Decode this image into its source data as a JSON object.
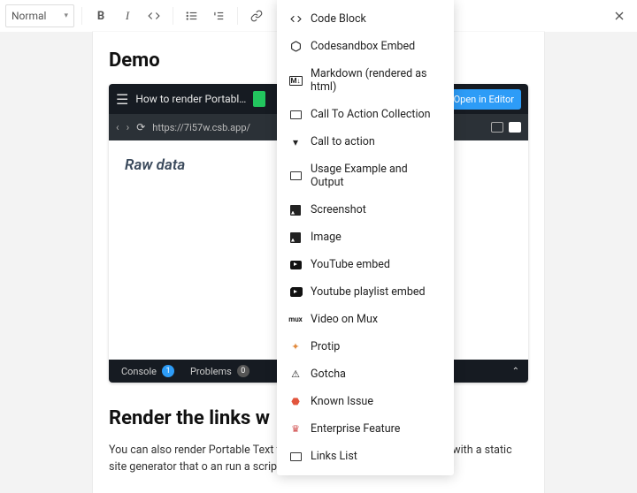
{
  "toolbar": {
    "format_select": "Normal"
  },
  "content": {
    "heading_demo": "Demo",
    "embed": {
      "title": "How to render Portabl…",
      "open_in_editor": "Open in Editor",
      "url": "https://7i57w.csb.app/",
      "body_title": "Raw data",
      "tab_console": "Console",
      "console_count": "1",
      "tab_problems": "Problems",
      "problems_count": "0"
    },
    "heading_render": "Render the links w",
    "paragraph": "You can also render Portable Text to Ma                                                     nt to use content from Sanity with a static site generator that o                                                     an run a script that"
  },
  "menu": {
    "items": [
      {
        "icon": "code-block-icon",
        "label": "Code Block"
      },
      {
        "icon": "codesandbox-icon",
        "label": "Codesandbox Embed"
      },
      {
        "icon": "markdown-icon",
        "label": "Markdown (rendered as html)"
      },
      {
        "icon": "cta-collection-icon",
        "label": "Call To Action Collection"
      },
      {
        "icon": "cta-icon",
        "label": "Call to action"
      },
      {
        "icon": "usage-icon",
        "label": "Usage Example and Output"
      },
      {
        "icon": "screenshot-icon",
        "label": "Screenshot"
      },
      {
        "icon": "image-icon",
        "label": "Image"
      },
      {
        "icon": "youtube-icon",
        "label": "YouTube embed"
      },
      {
        "icon": "youtube-playlist-icon",
        "label": "Youtube playlist embed"
      },
      {
        "icon": "mux-icon",
        "label": "Video on Mux"
      },
      {
        "icon": "protip-icon",
        "label": "Protip"
      },
      {
        "icon": "gotcha-icon",
        "label": "Gotcha"
      },
      {
        "icon": "known-issue-icon",
        "label": "Known Issue"
      },
      {
        "icon": "enterprise-icon",
        "label": "Enterprise Feature"
      },
      {
        "icon": "links-list-icon",
        "label": "Links List"
      }
    ]
  }
}
